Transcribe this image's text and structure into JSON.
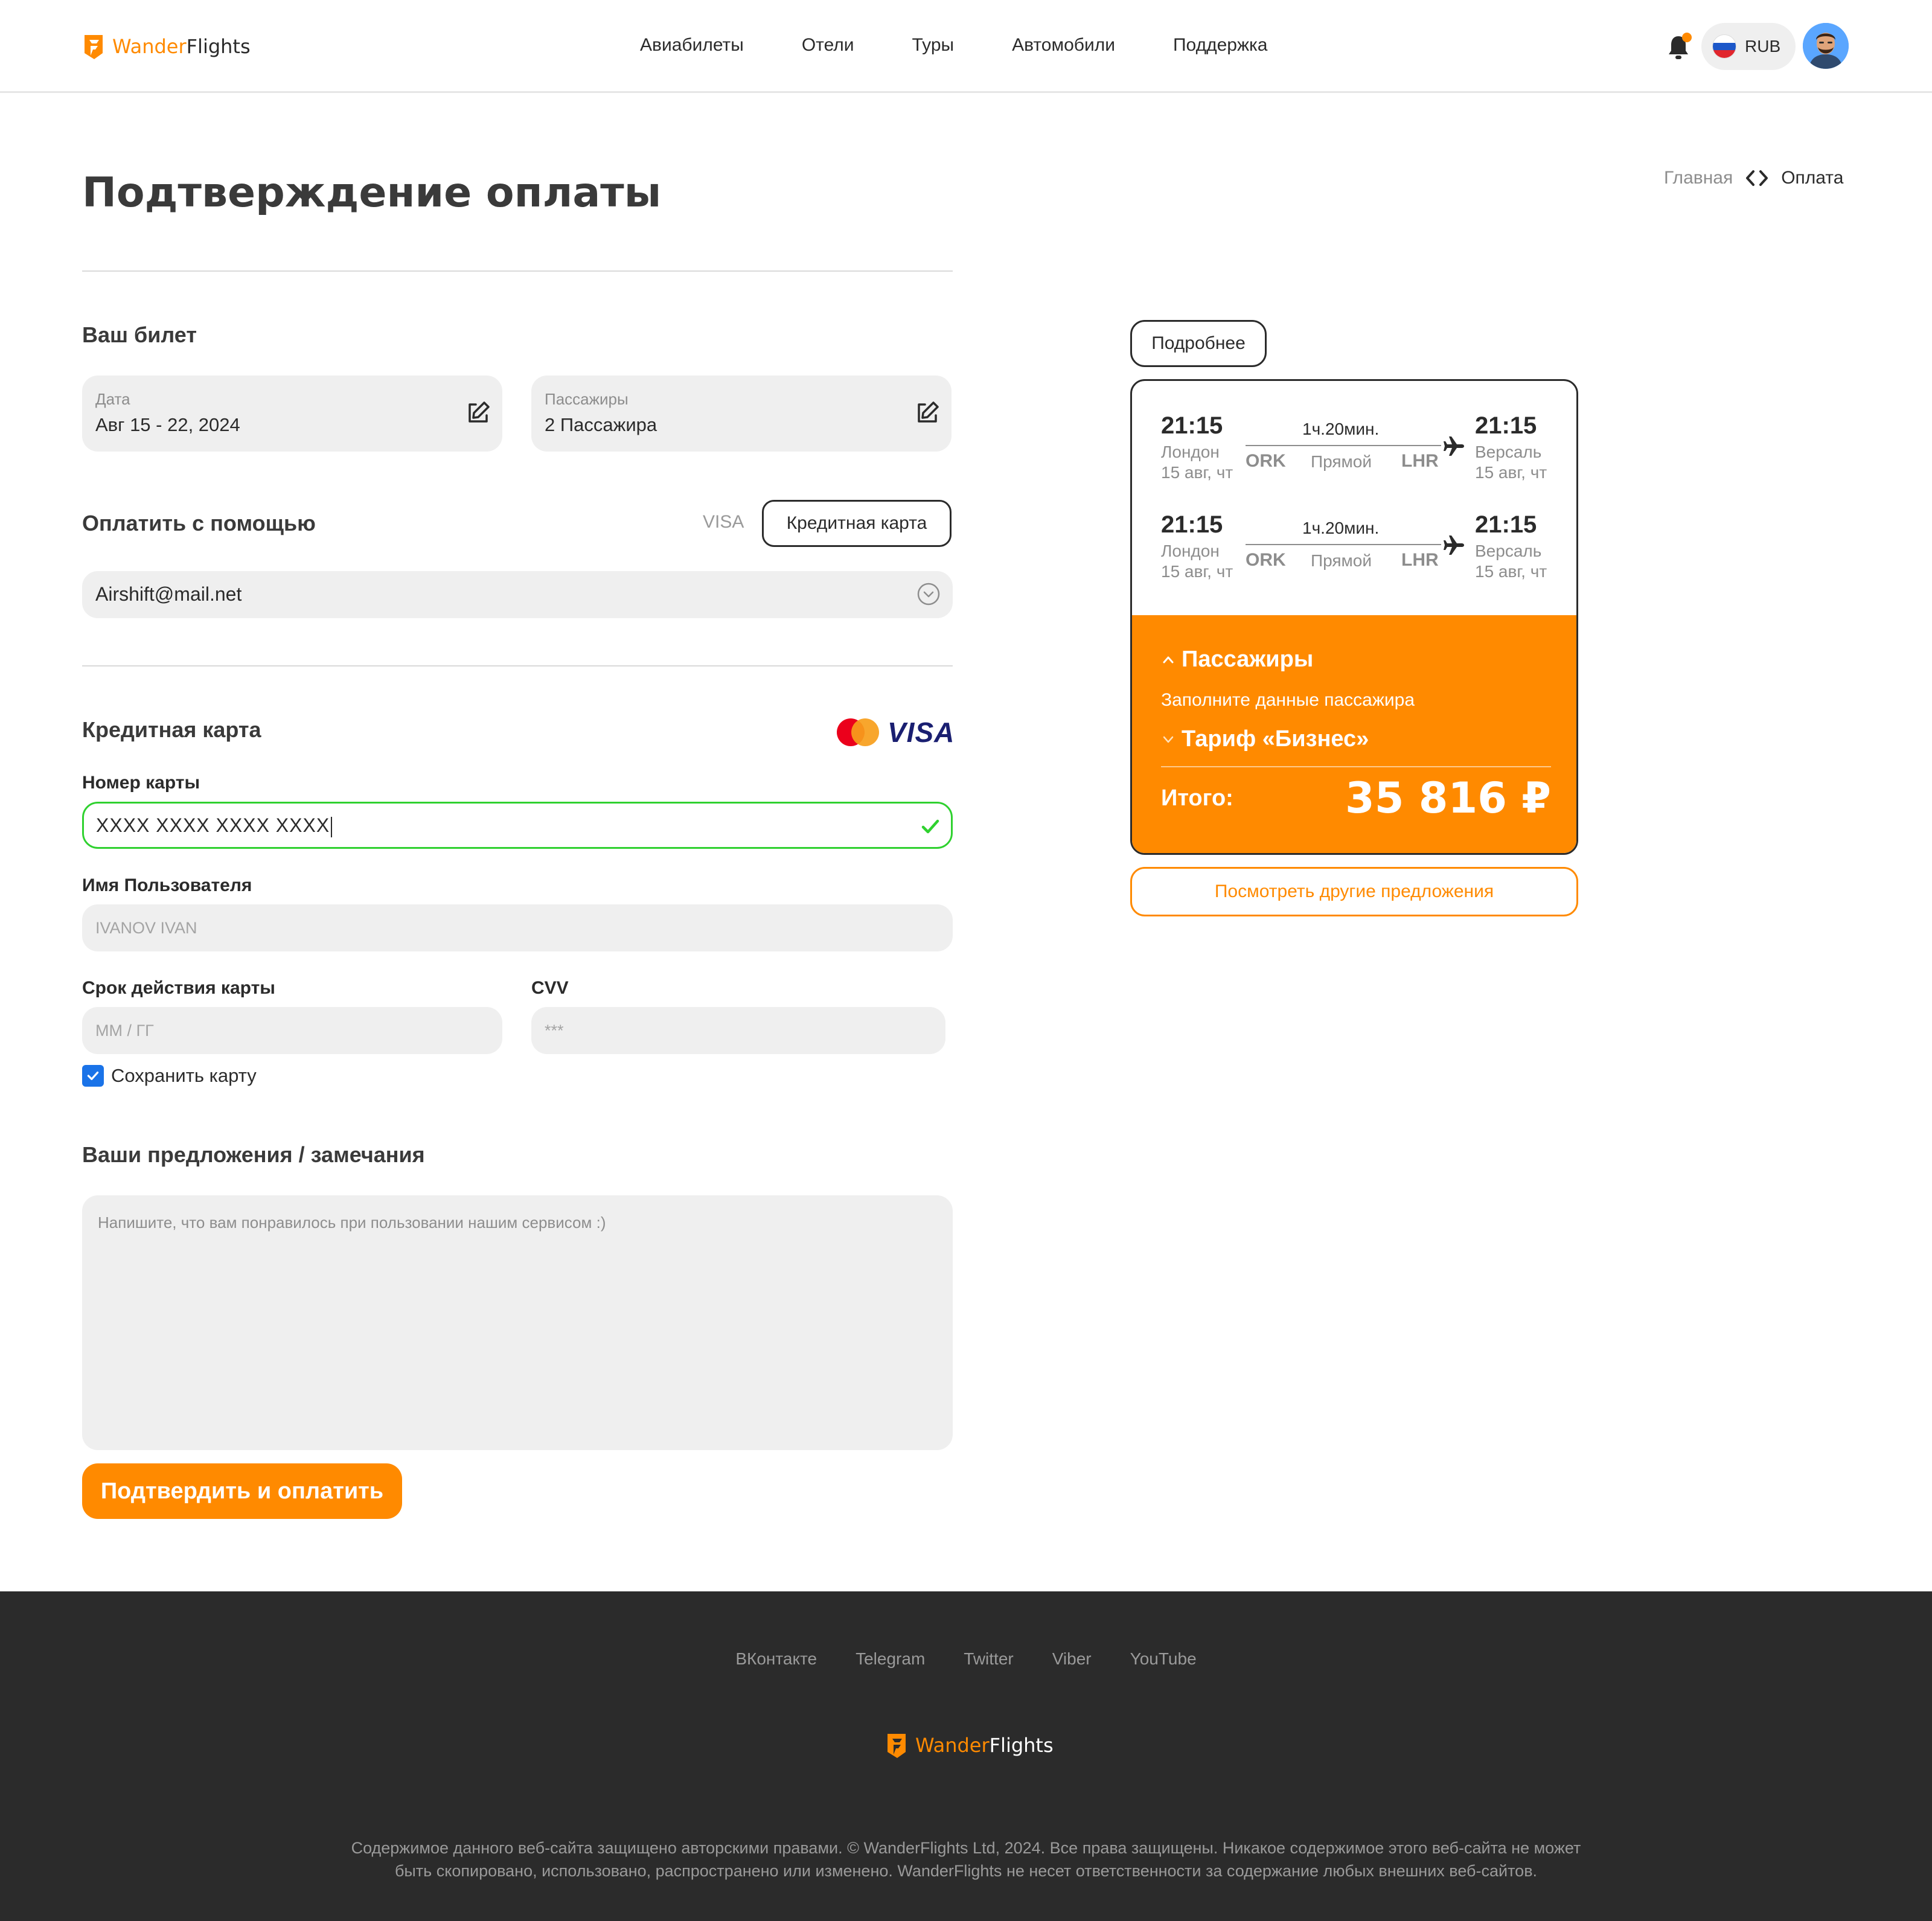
{
  "colors": {
    "accent": "#ff8a00",
    "text": "#2b2b2b",
    "muted": "#8d8d8d",
    "field_bg": "#efefef",
    "success": "#2fd12f",
    "footer_bg": "#2b2b2b"
  },
  "brand": {
    "part1": "Wander",
    "part2": "Flights"
  },
  "header": {
    "nav": [
      "Авиабилеты",
      "Отели",
      "Туры",
      "Автомобили",
      "Поддержка"
    ],
    "currency": "RUB",
    "icons": {
      "notification": "bell-icon",
      "flag": "russia-flag-icon",
      "avatar": "user-avatar"
    }
  },
  "page": {
    "title": "Подтверждение оплаты",
    "breadcrumb": {
      "home": "Главная",
      "current": "Оплата"
    }
  },
  "ticket": {
    "heading": "Ваш билет",
    "date_label": "Дата",
    "date_value": "Авг 15 - 22, 2024",
    "passengers_label": "Пассажиры",
    "passengers_value": "2 Пассажира"
  },
  "payment": {
    "heading": "Оплатить с помощью",
    "option_visa": "VISA",
    "option_card": "Кредитная карта",
    "email": "Airshift@mail.net"
  },
  "card": {
    "heading": "Кредитная карта",
    "visa_logo": "VISA",
    "number_label": "Номер карты",
    "number_value": "XXXX XXXX XXXX XXXX",
    "name_label": "Имя Пользователя",
    "name_placeholder": "IVANOV IVAN",
    "expiry_label": "Срок действия карты",
    "expiry_placeholder": "MM / ГГ",
    "cvv_label": "CVV",
    "cvv_placeholder": "***",
    "save_label": "Сохранить карту",
    "save_checked": true
  },
  "feedback": {
    "heading": "Ваши предложения / замечания",
    "placeholder": "Напишите, что вам понравилось при пользовании нашим сервисом :)"
  },
  "submit_label": "Подтвердить и оплатить",
  "summary": {
    "details_button": "Подробнее",
    "flights": [
      {
        "dep_time": "21:15",
        "dep_city": "Лондон",
        "dep_date": "15 авг, чт",
        "duration": "1ч.20мин.",
        "from_code": "ORK",
        "type": "Прямой",
        "to_code": "LHR",
        "arr_time": "21:15",
        "arr_city": "Версаль",
        "arr_date": "15 авг, чт"
      },
      {
        "dep_time": "21:15",
        "dep_city": "Лондон",
        "dep_date": "15 авг, чт",
        "duration": "1ч.20мин.",
        "from_code": "ORK",
        "type": "Прямой",
        "to_code": "LHR",
        "arr_time": "21:15",
        "arr_city": "Версаль",
        "arr_date": "15 авг, чт"
      }
    ],
    "passengers_title": "Пассажиры",
    "passengers_hint": "Заполните данные пассажира",
    "tariff": "Тариф «Бизнес»",
    "total_label": "Итого:",
    "total_value": "35 816 ₽",
    "offers_button": "Посмотреть другие предложения"
  },
  "footer": {
    "social": [
      "ВКонтакте",
      "Telegram",
      "Twitter",
      "Viber",
      "YouTube"
    ],
    "copyright_line1": "Содержимое данного веб-сайта защищено авторскими правами. © WanderFlights Ltd, 2024. Все права защищены. Никакое содержимое этого веб-сайта не может",
    "copyright_line2": "быть скопировано, использовано, распространено или изменено. WanderFlights не несет ответственности за содержание любых внешних веб-сайтов."
  }
}
